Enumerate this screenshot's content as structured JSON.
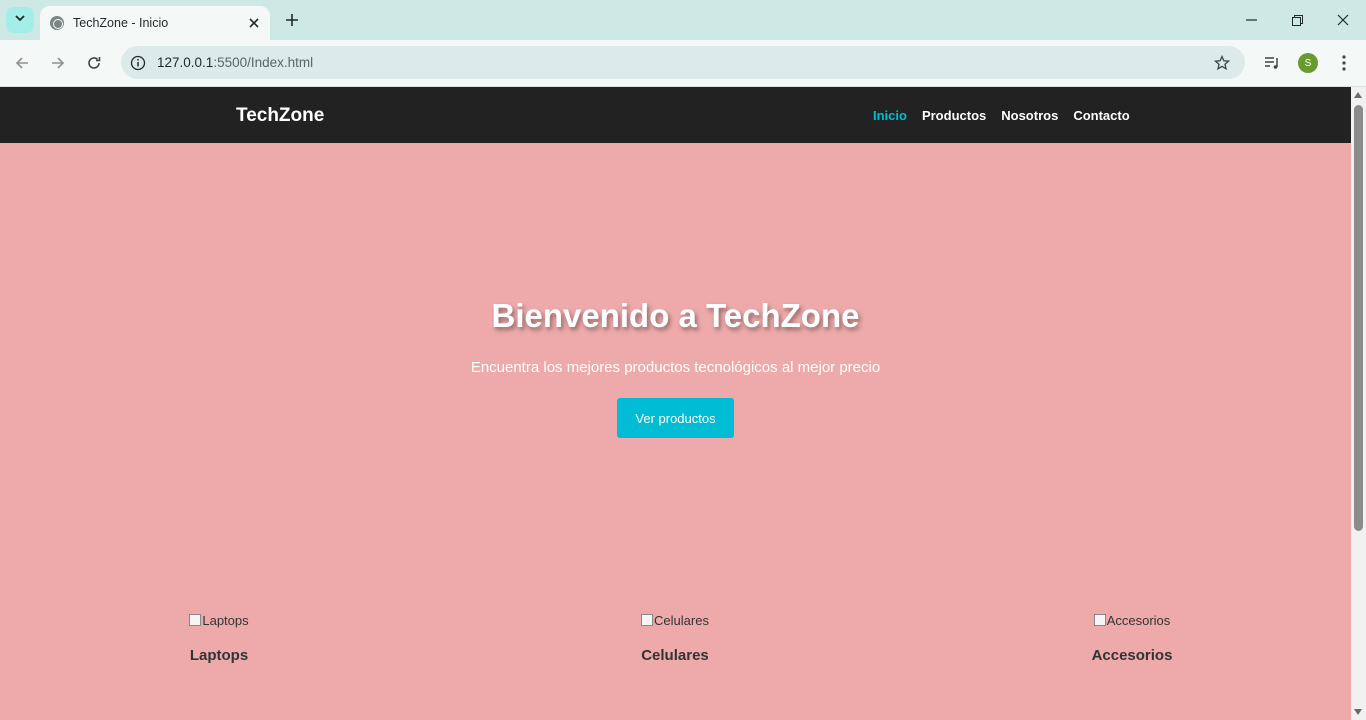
{
  "browser": {
    "tab_title": "TechZone - Inicio",
    "url_host": "127.0.0.1",
    "url_rest": ":5500/Index.html",
    "avatar_letter": "S"
  },
  "site": {
    "brand": "TechZone",
    "nav": [
      {
        "label": "Inicio",
        "active": true
      },
      {
        "label": "Productos",
        "active": false
      },
      {
        "label": "Nosotros",
        "active": false
      },
      {
        "label": "Contacto",
        "active": false
      }
    ],
    "hero": {
      "title": "Bienvenido a TechZone",
      "subtitle": "Encuentra los mejores productos tecnológicos al mejor precio",
      "button": "Ver productos"
    },
    "categories": [
      {
        "alt": "Laptops",
        "name": "Laptops"
      },
      {
        "alt": "Celulares",
        "name": "Celulares"
      },
      {
        "alt": "Accesorios",
        "name": "Accesorios"
      }
    ]
  },
  "colors": {
    "page_bg": "#eeaaaa",
    "navbar_bg": "#222222",
    "accent": "#00bcd4"
  }
}
